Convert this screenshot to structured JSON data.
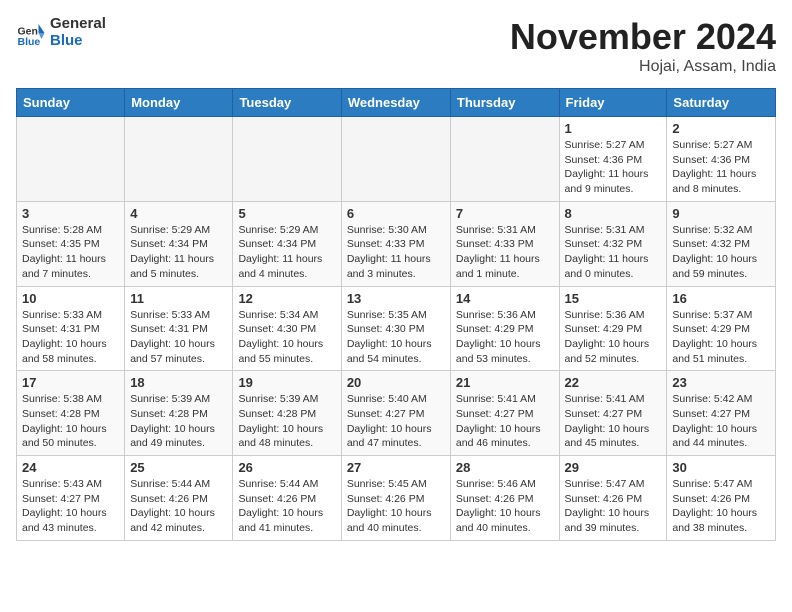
{
  "logo": {
    "general": "General",
    "blue": "Blue"
  },
  "title": "November 2024",
  "location": "Hojai, Assam, India",
  "weekdays": [
    "Sunday",
    "Monday",
    "Tuesday",
    "Wednesday",
    "Thursday",
    "Friday",
    "Saturday"
  ],
  "weeks": [
    [
      {
        "day": "",
        "info": ""
      },
      {
        "day": "",
        "info": ""
      },
      {
        "day": "",
        "info": ""
      },
      {
        "day": "",
        "info": ""
      },
      {
        "day": "",
        "info": ""
      },
      {
        "day": "1",
        "info": "Sunrise: 5:27 AM\nSunset: 4:36 PM\nDaylight: 11 hours and 9 minutes."
      },
      {
        "day": "2",
        "info": "Sunrise: 5:27 AM\nSunset: 4:36 PM\nDaylight: 11 hours and 8 minutes."
      }
    ],
    [
      {
        "day": "3",
        "info": "Sunrise: 5:28 AM\nSunset: 4:35 PM\nDaylight: 11 hours and 7 minutes."
      },
      {
        "day": "4",
        "info": "Sunrise: 5:29 AM\nSunset: 4:34 PM\nDaylight: 11 hours and 5 minutes."
      },
      {
        "day": "5",
        "info": "Sunrise: 5:29 AM\nSunset: 4:34 PM\nDaylight: 11 hours and 4 minutes."
      },
      {
        "day": "6",
        "info": "Sunrise: 5:30 AM\nSunset: 4:33 PM\nDaylight: 11 hours and 3 minutes."
      },
      {
        "day": "7",
        "info": "Sunrise: 5:31 AM\nSunset: 4:33 PM\nDaylight: 11 hours and 1 minute."
      },
      {
        "day": "8",
        "info": "Sunrise: 5:31 AM\nSunset: 4:32 PM\nDaylight: 11 hours and 0 minutes."
      },
      {
        "day": "9",
        "info": "Sunrise: 5:32 AM\nSunset: 4:32 PM\nDaylight: 10 hours and 59 minutes."
      }
    ],
    [
      {
        "day": "10",
        "info": "Sunrise: 5:33 AM\nSunset: 4:31 PM\nDaylight: 10 hours and 58 minutes."
      },
      {
        "day": "11",
        "info": "Sunrise: 5:33 AM\nSunset: 4:31 PM\nDaylight: 10 hours and 57 minutes."
      },
      {
        "day": "12",
        "info": "Sunrise: 5:34 AM\nSunset: 4:30 PM\nDaylight: 10 hours and 55 minutes."
      },
      {
        "day": "13",
        "info": "Sunrise: 5:35 AM\nSunset: 4:30 PM\nDaylight: 10 hours and 54 minutes."
      },
      {
        "day": "14",
        "info": "Sunrise: 5:36 AM\nSunset: 4:29 PM\nDaylight: 10 hours and 53 minutes."
      },
      {
        "day": "15",
        "info": "Sunrise: 5:36 AM\nSunset: 4:29 PM\nDaylight: 10 hours and 52 minutes."
      },
      {
        "day": "16",
        "info": "Sunrise: 5:37 AM\nSunset: 4:29 PM\nDaylight: 10 hours and 51 minutes."
      }
    ],
    [
      {
        "day": "17",
        "info": "Sunrise: 5:38 AM\nSunset: 4:28 PM\nDaylight: 10 hours and 50 minutes."
      },
      {
        "day": "18",
        "info": "Sunrise: 5:39 AM\nSunset: 4:28 PM\nDaylight: 10 hours and 49 minutes."
      },
      {
        "day": "19",
        "info": "Sunrise: 5:39 AM\nSunset: 4:28 PM\nDaylight: 10 hours and 48 minutes."
      },
      {
        "day": "20",
        "info": "Sunrise: 5:40 AM\nSunset: 4:27 PM\nDaylight: 10 hours and 47 minutes."
      },
      {
        "day": "21",
        "info": "Sunrise: 5:41 AM\nSunset: 4:27 PM\nDaylight: 10 hours and 46 minutes."
      },
      {
        "day": "22",
        "info": "Sunrise: 5:41 AM\nSunset: 4:27 PM\nDaylight: 10 hours and 45 minutes."
      },
      {
        "day": "23",
        "info": "Sunrise: 5:42 AM\nSunset: 4:27 PM\nDaylight: 10 hours and 44 minutes."
      }
    ],
    [
      {
        "day": "24",
        "info": "Sunrise: 5:43 AM\nSunset: 4:27 PM\nDaylight: 10 hours and 43 minutes."
      },
      {
        "day": "25",
        "info": "Sunrise: 5:44 AM\nSunset: 4:26 PM\nDaylight: 10 hours and 42 minutes."
      },
      {
        "day": "26",
        "info": "Sunrise: 5:44 AM\nSunset: 4:26 PM\nDaylight: 10 hours and 41 minutes."
      },
      {
        "day": "27",
        "info": "Sunrise: 5:45 AM\nSunset: 4:26 PM\nDaylight: 10 hours and 40 minutes."
      },
      {
        "day": "28",
        "info": "Sunrise: 5:46 AM\nSunset: 4:26 PM\nDaylight: 10 hours and 40 minutes."
      },
      {
        "day": "29",
        "info": "Sunrise: 5:47 AM\nSunset: 4:26 PM\nDaylight: 10 hours and 39 minutes."
      },
      {
        "day": "30",
        "info": "Sunrise: 5:47 AM\nSunset: 4:26 PM\nDaylight: 10 hours and 38 minutes."
      }
    ]
  ]
}
